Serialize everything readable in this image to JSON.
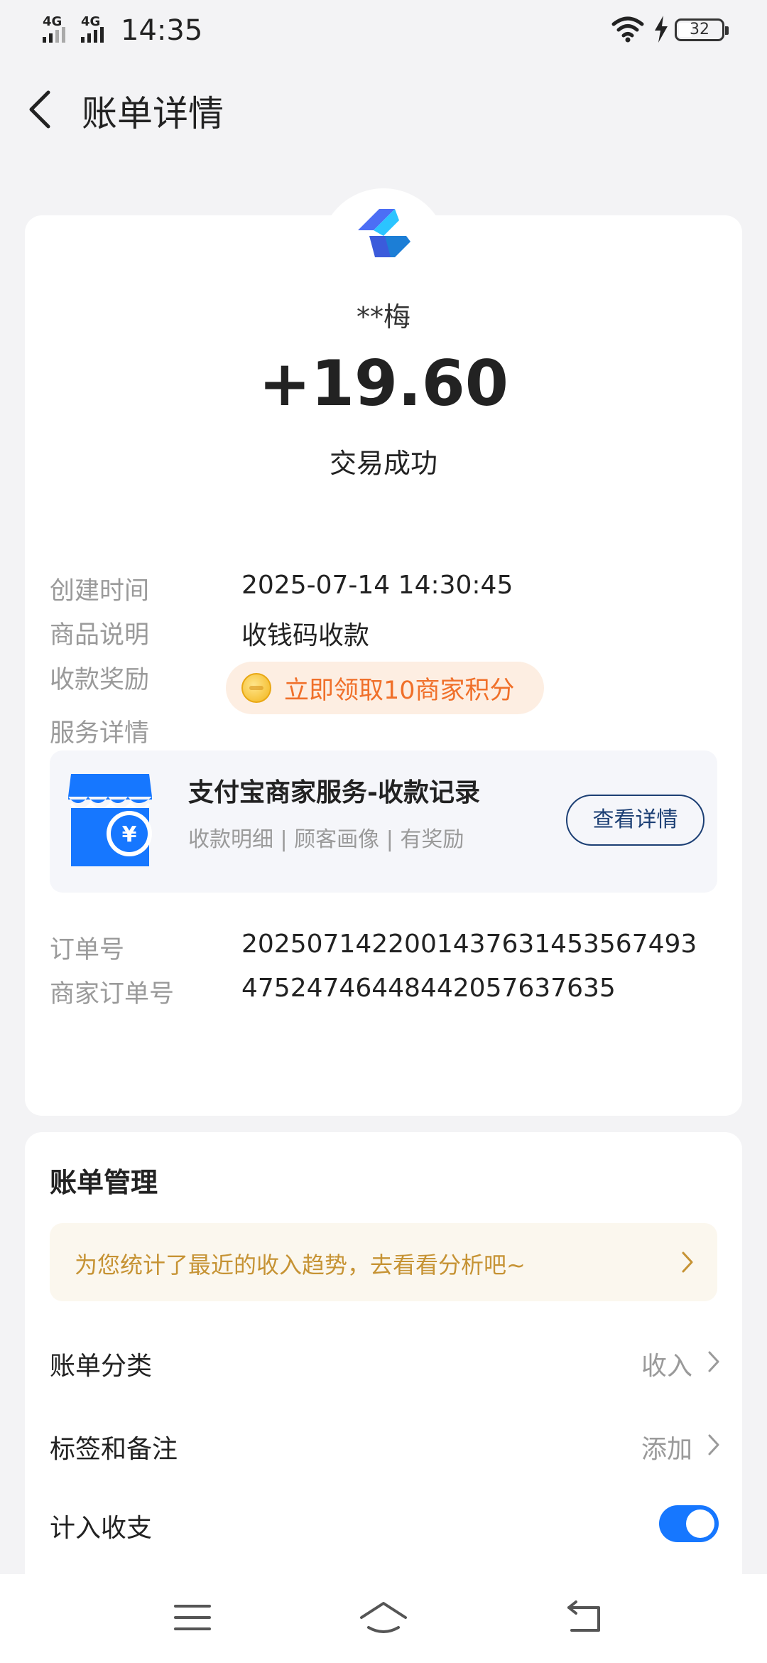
{
  "status_bar": {
    "signal1_label": "4G",
    "signal2_label": "4G",
    "time": "14:35",
    "battery": "32",
    "icons": [
      "signal-icon",
      "wifi-icon",
      "charging-icon",
      "battery-icon"
    ]
  },
  "header": {
    "title": "账单详情",
    "back_icon": "chevron-left-icon"
  },
  "transaction": {
    "payer": "**梅",
    "amount": "+19.60",
    "status": "交易成功"
  },
  "details": {
    "created_label": "创建时间",
    "created_value": "2025-07-14 14:30:45",
    "product_label": "商品说明",
    "product_value": "收钱码收款",
    "reward_label": "收款奖励",
    "reward_text": "立即领取10商家积分",
    "service_label": "服务详情",
    "order_label": "订单号",
    "order_value": "2025071422001437631453567493",
    "merchant_order_label": "商家订单号",
    "merchant_order_value": "47524746448442057637635"
  },
  "service": {
    "title": "支付宝商家服务-收款记录",
    "subtitle": "收款明细 | 顾客画像 | 有奖励",
    "button": "查看详情"
  },
  "management": {
    "title": "账单管理",
    "tip": "为您统计了最近的收入趋势，去看看分析吧~",
    "category_label": "账单分类",
    "category_value": "收入",
    "tags_label": "标签和备注",
    "tags_value": "添加",
    "include_label": "计入收支",
    "include_on": true
  },
  "colors": {
    "accent": "#1677ff",
    "reward": "#f0702a",
    "tip": "#c69334",
    "button_border": "#1c3f74"
  }
}
